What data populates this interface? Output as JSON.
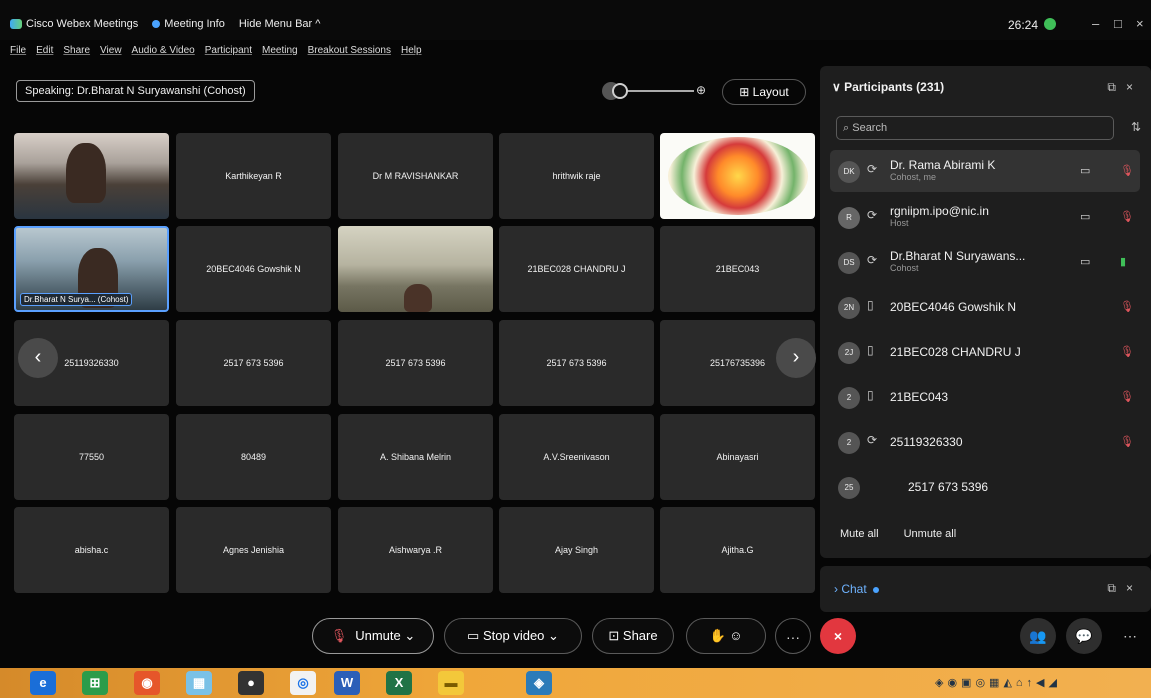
{
  "window": {
    "app_title": "Cisco Webex Meetings",
    "meeting_info": "Meeting Info",
    "hide_menu": "Hide Menu Bar ^",
    "timer": "26:24",
    "minimize": "–",
    "maximize": "□",
    "close": "×"
  },
  "menu": [
    "File",
    "Edit",
    "Share",
    "View",
    "Audio & Video",
    "Participant",
    "Meeting",
    "Breakout Sessions",
    "Help"
  ],
  "stage": {
    "speaking": "Speaking: Dr.Bharat N Suryawanshi (Cohost)",
    "zoom_plus": "⊕",
    "layout_label": "⊞ Layout",
    "prev_arrow": "‹",
    "next_arrow": "›"
  },
  "tiles": [
    "",
    "Karthikeyan R",
    "Dr M RAVISHANKAR",
    "hrithwik raje",
    "",
    "Dr.Bharat N Surya... (Cohost)",
    "20BEC4046 Gowshik N",
    "",
    "21BEC028 CHANDRU J",
    "21BEC043",
    "25119326330",
    "2517 673 5396",
    "2517 673 5396",
    "2517 673 5396",
    "25176735396",
    "77550",
    "80489",
    "A. Shibana Melrin",
    "A.V.Sreenivason",
    "Abinayasri",
    "abisha.c",
    "Agnes Jenishia",
    "Aishwarya .R",
    "Ajay Singh",
    "Ajitha.G"
  ],
  "participants": {
    "header": "Participants (231)",
    "collapse": "∨",
    "popout": "⧉",
    "close": "×",
    "search_placeholder": "Search",
    "sort": "⇅",
    "mute_all": "Mute all",
    "unmute_all": "Unmute all",
    "list": [
      {
        "initials": "DK",
        "name": "Dr. Rama Abirami K",
        "role": "Cohost, me",
        "device": "⟳",
        "camera": "▭",
        "mic": "muted"
      },
      {
        "initials": "R",
        "name": "rgniipm.ipo@nic.in",
        "role": "Host",
        "device": "⟳",
        "camera": "▭",
        "mic": "muted"
      },
      {
        "initials": "DS",
        "name": "Dr.Bharat N Suryawans...",
        "role": "Cohost",
        "device": "⟳",
        "camera": "▭",
        "mic": "on"
      },
      {
        "initials": "2N",
        "name": "20BEC4046 Gowshik N",
        "role": "",
        "device": "▯",
        "camera": "",
        "mic": "muted"
      },
      {
        "initials": "2J",
        "name": "21BEC028 CHANDRU J",
        "role": "",
        "device": "▯",
        "camera": "",
        "mic": "muted"
      },
      {
        "initials": "2",
        "name": "21BEC043",
        "role": "",
        "device": "▯",
        "camera": "",
        "mic": "muted"
      },
      {
        "initials": "2",
        "name": "25119326330",
        "role": "",
        "device": "⟳",
        "camera": "",
        "mic": "muted"
      },
      {
        "initials": "25",
        "name": "2517 673 5396",
        "role": "",
        "device": "",
        "camera": "",
        "mic": ""
      }
    ]
  },
  "chat": {
    "label": "Chat",
    "popout": "⧉",
    "close": "×"
  },
  "controls": {
    "unmute": "Unmute",
    "stop_video": "Stop video",
    "share": "Share",
    "more": "···",
    "leave": "×"
  },
  "colors": {
    "accent": "#4aa3ff",
    "muted_red": "#e0565d",
    "leave_red": "#e2373f",
    "online_green": "#3fbf58"
  }
}
